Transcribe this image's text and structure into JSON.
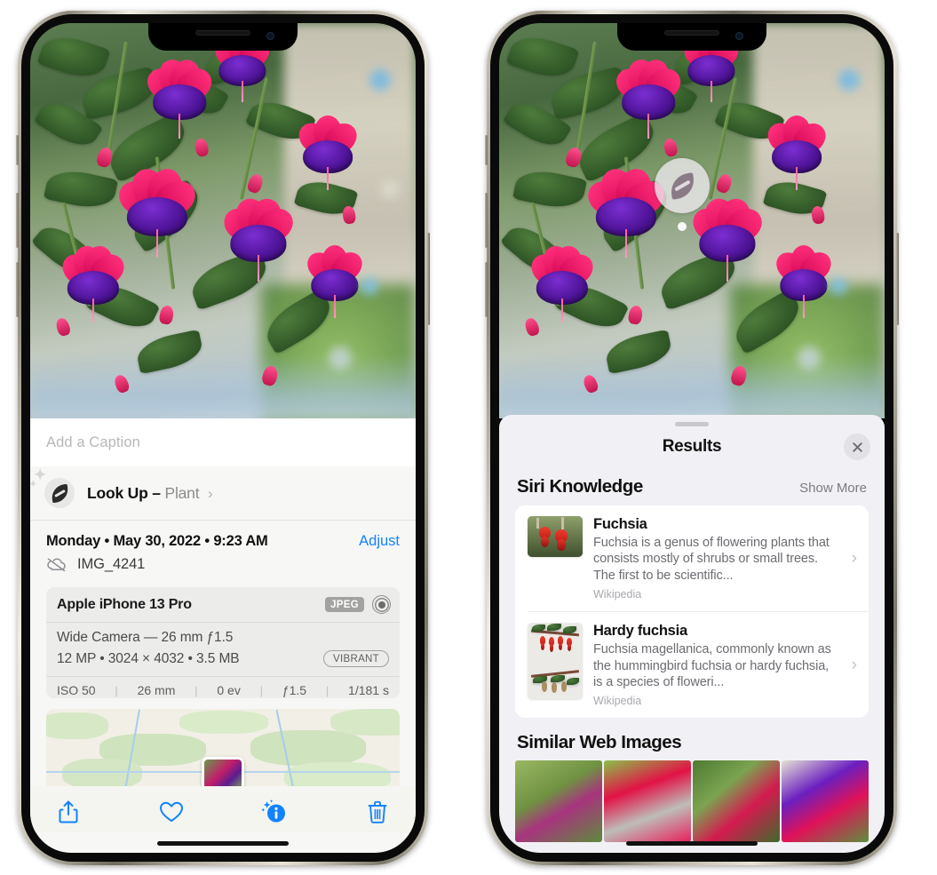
{
  "left_phone": {
    "caption_placeholder": "Add a Caption",
    "lookup": {
      "label": "Look Up",
      "dash": "–",
      "subject": "Plant",
      "chevron": "›",
      "icon": "leaf-icon"
    },
    "meta": {
      "date": "Monday • May 30, 2022 • 9:23 AM",
      "adjust": "Adjust",
      "filename": "IMG_4241",
      "cloud_icon": "cloud-slash-icon"
    },
    "exif": {
      "device": "Apple iPhone 13 Pro",
      "format_chip": "JPEG",
      "raw_icon": "raw-ring-icon",
      "lens": "Wide Camera — 26 mm ƒ1.5",
      "size_line": "12 MP • 3024 × 4032 • 3.5 MB",
      "style_chip": "VIBRANT",
      "stats": [
        "ISO 50",
        "26 mm",
        "0 ev",
        "ƒ1.5",
        "1/181 s"
      ],
      "separator": "|"
    },
    "toolbar": {
      "share": "share-icon",
      "favorite": "heart-icon",
      "info": "info-sparkle-icon",
      "delete": "trash-icon"
    }
  },
  "right_phone": {
    "visual_lookup_badge": "leaf-icon",
    "sheet": {
      "title": "Results",
      "close": "close-icon"
    },
    "siri_knowledge": {
      "heading": "Siri Knowledge",
      "action": "Show More",
      "items": [
        {
          "title": "Fuchsia",
          "description": "Fuchsia is a genus of flowering plants that consists mostly of shrubs or small trees. The first to be scientific...",
          "source": "Wikipedia",
          "chevron": "›"
        },
        {
          "title": "Hardy fuchsia",
          "description": "Fuchsia magellanica, commonly known as the hummingbird fuchsia or hardy fuchsia, is a species of floweri...",
          "source": "Wikipedia",
          "chevron": "›"
        }
      ]
    },
    "similar_web_images": {
      "heading": "Similar Web Images",
      "count": 4
    }
  },
  "colors": {
    "accent_blue": "#1283ff",
    "sheet_bg": "#f1f1f5",
    "card_bg": "#ffffff",
    "text_primary": "#111111",
    "text_secondary": "#6c6c72"
  }
}
